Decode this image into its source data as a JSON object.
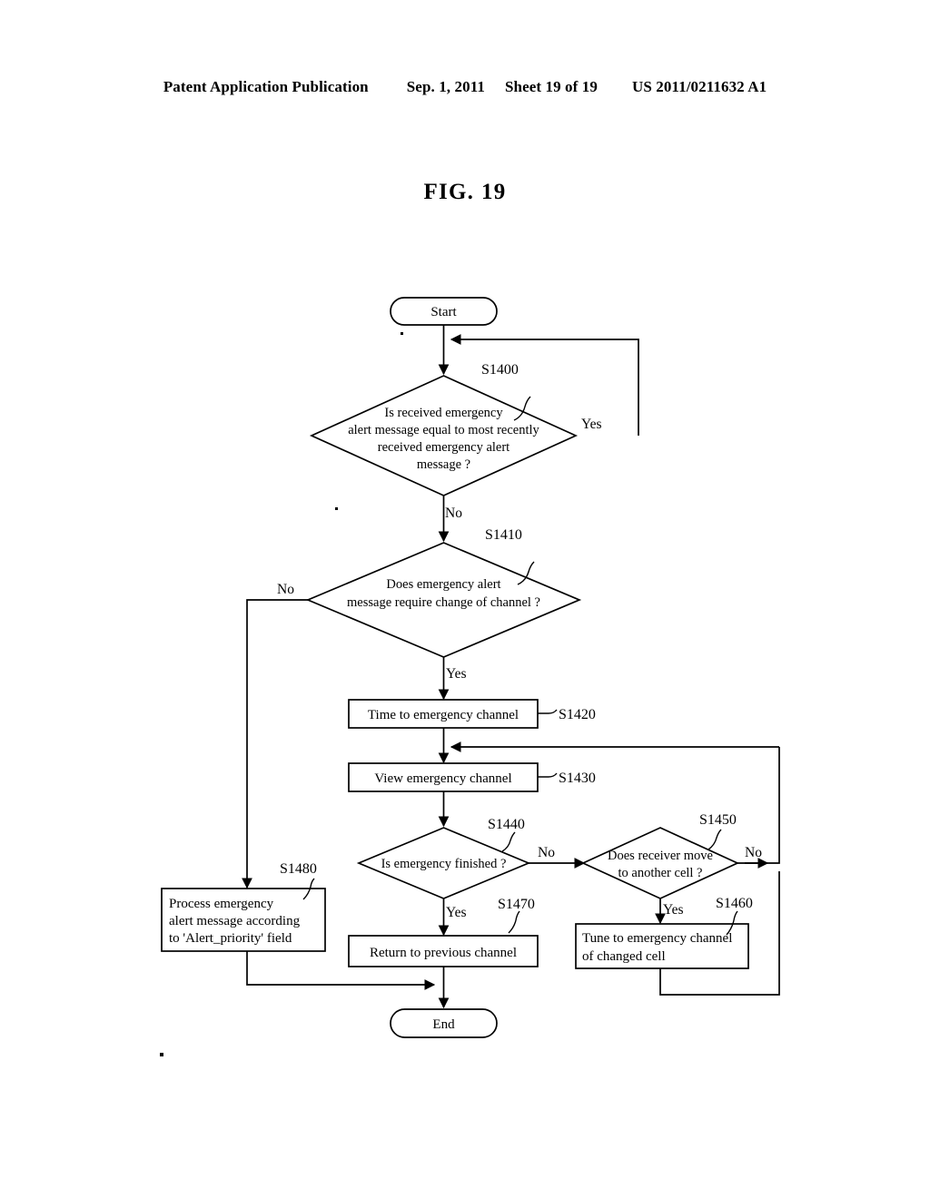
{
  "header": {
    "publication": "Patent Application Publication",
    "date": "Sep. 1, 2011",
    "sheet": "Sheet 19 of 19",
    "number": "US 2011/0211632 A1"
  },
  "figure": {
    "label": "FIG.",
    "number": "19"
  },
  "flowchart": {
    "terminators": {
      "start": "Start",
      "end": "End"
    },
    "nodes": [
      {
        "id": "S1400",
        "step": "S1400",
        "type": "decision",
        "lines": [
          "Is received emergency",
          "alert message equal to most recently",
          "received emergency alert",
          "message ?"
        ]
      },
      {
        "id": "S1410",
        "step": "S1410",
        "type": "decision",
        "lines": [
          "Does emergency alert",
          "message require change of channel ?"
        ]
      },
      {
        "id": "S1420",
        "step": "S1420",
        "type": "process",
        "lines": [
          "Time to emergency channel"
        ]
      },
      {
        "id": "S1430",
        "step": "S1430",
        "type": "process",
        "lines": [
          "View emergency channel"
        ]
      },
      {
        "id": "S1440",
        "step": "S1440",
        "type": "decision",
        "lines": [
          "Is emergency finished ?"
        ]
      },
      {
        "id": "S1450",
        "step": "S1450",
        "type": "decision",
        "lines": [
          "Does receiver move",
          "to another cell ?"
        ]
      },
      {
        "id": "S1460",
        "step": "S1460",
        "type": "process",
        "lines": [
          "Tune to emergency channel",
          "of changed cell"
        ]
      },
      {
        "id": "S1470",
        "step": "S1470",
        "type": "process",
        "lines": [
          "Return to previous channel"
        ]
      },
      {
        "id": "S1480",
        "step": "S1480",
        "type": "process",
        "lines": [
          "Process emergency",
          "alert message according",
          "to 'Alert_priority' field"
        ]
      }
    ],
    "branch_labels": {
      "s1400_yes": "Yes",
      "s1400_no": "No",
      "s1410_no": "No",
      "s1410_yes": "Yes",
      "s1440_no": "No",
      "s1440_yes": "Yes",
      "s1450_no": "No",
      "s1450_yes": "Yes"
    }
  },
  "colors": {
    "ink": "#000000",
    "paper": "#ffffff"
  }
}
